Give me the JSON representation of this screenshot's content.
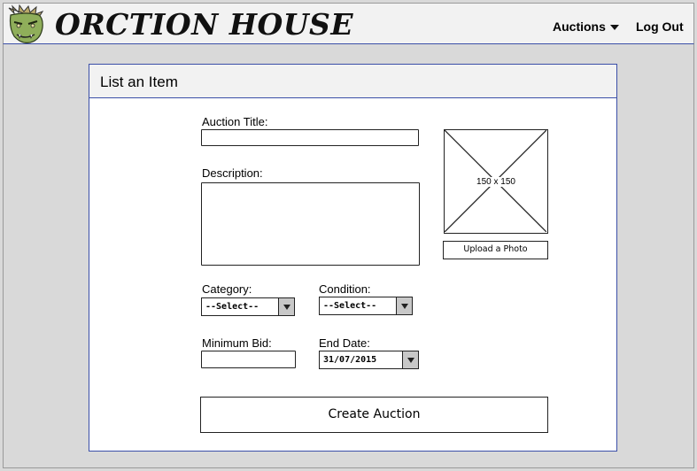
{
  "header": {
    "brand": "ORCTION HOUSE",
    "nav_auctions": "Auctions",
    "nav_logout": "Log Out"
  },
  "panel": {
    "title": "List an Item"
  },
  "form": {
    "auction_title_label": "Auction Title:",
    "auction_title_value": "",
    "description_label": "Description:",
    "description_value": "",
    "category_label": "Category:",
    "category_selected": "--Select--",
    "condition_label": "Condition:",
    "condition_selected": "--Select--",
    "min_bid_label": "Minimum Bid:",
    "min_bid_value": "",
    "end_date_label": "End Date:",
    "end_date_value": "31/07/2015",
    "image_placeholder": "150 x 150",
    "upload_label": "Upload a Photo",
    "submit_label": "Create Auction"
  },
  "colors": {
    "accent_border": "#3b4fa8",
    "header_bg": "#f2f2f2",
    "page_bg": "#d9d9d9"
  }
}
